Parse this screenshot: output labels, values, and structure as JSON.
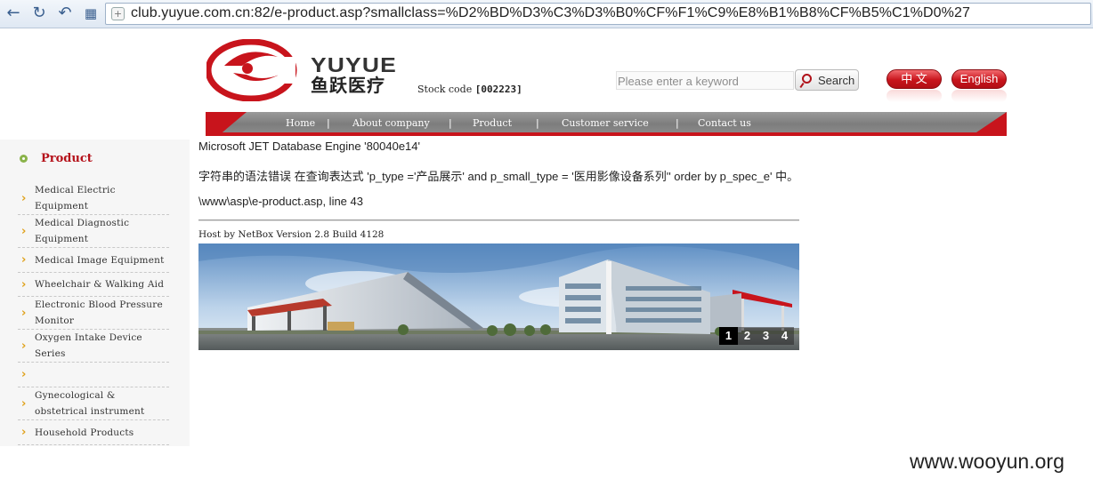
{
  "browser": {
    "url": "club.yuyue.com.cn:82/e-product.asp?smallclass=%D2%BD%D3%C3%D3%B0%CF%F1%C9%E8%B1%B8%CF%B5%C1%D0%27",
    "icons": [
      "back-icon",
      "refresh-icon",
      "undo-icon",
      "apps-grid-icon",
      "page-icon"
    ]
  },
  "header": {
    "logo_en": "YUYUE",
    "logo_cn": "鱼跃医疗",
    "stock_label": "Stock code",
    "stock_code": "[002223]",
    "search_placeholder": "Please enter a keyword",
    "search_label": "Search",
    "lang_cn": "中 文",
    "lang_en": "English",
    "brand_color": "#c8141c"
  },
  "nav": {
    "items": [
      {
        "label": "Home"
      },
      {
        "label": "About company"
      },
      {
        "label": "Product"
      },
      {
        "label": "Customer service"
      },
      {
        "label": "Contact us"
      }
    ],
    "separator": "|"
  },
  "sidebar": {
    "title": "Product",
    "items": [
      {
        "label": "Medical Electric Equipment"
      },
      {
        "label": "Medical Diagnostic Equipment"
      },
      {
        "label": "Medical Image Equipment"
      },
      {
        "label": "Wheelchair & Walking Aid"
      },
      {
        "label": "Electronic Blood Pressure Monitor"
      },
      {
        "label": "Oxygen Intake Device Series"
      },
      {
        "label": ""
      },
      {
        "label": "Gynecological & obstetrical instrument"
      },
      {
        "label": "Household Products"
      }
    ]
  },
  "error": {
    "engine": "Microsoft JET Database Engine '80040e14'",
    "message": "字符串的语法错误 在查询表达式 'p_type ='产品展示' and p_small_type = '医用影像设备系列'' order by p_spec_e' 中。",
    "location": "\\www\\asp\\e-product.asp, line 43",
    "host": "Host by NetBox Version 2.8 Build 4128"
  },
  "banner": {
    "pages": [
      "1",
      "2",
      "3",
      "4"
    ],
    "active_page": "1"
  },
  "watermark": "www.wooyun.org"
}
